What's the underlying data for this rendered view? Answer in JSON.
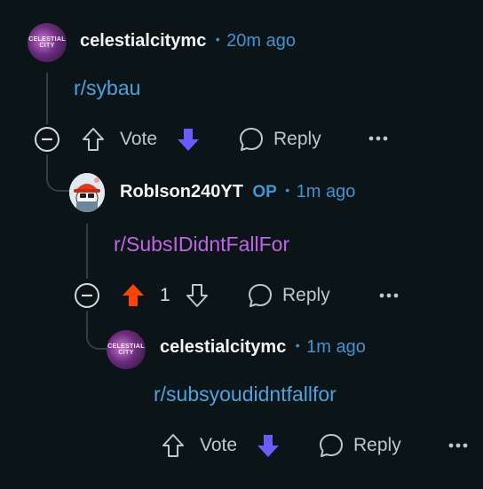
{
  "comments": [
    {
      "username": "celestialcitymc",
      "time": "20m ago",
      "body": "r/sybau",
      "vote_label": "Vote",
      "reply_label": "Reply",
      "avatar_text": "CELESTIAL CITY"
    },
    {
      "username": "RobIson240YT",
      "op_badge": "OP",
      "time": "1m ago",
      "body": "r/SubsIDidntFallFor",
      "vote_count": "1",
      "reply_label": "Reply"
    },
    {
      "username": "celestialcitymc",
      "time": "1m ago",
      "body": "r/subsyoudidntfallfor",
      "vote_label": "Vote",
      "reply_label": "Reply",
      "avatar_text": "CELESTIAL CITY"
    }
  ],
  "separator": "•",
  "icons": {
    "collapse": "minus-circle-icon",
    "upvote": "arrow-up-icon",
    "downvote": "arrow-down-icon",
    "reply": "speech-bubble-icon",
    "more": "ellipsis-icon"
  },
  "colors": {
    "background": "#0b1416",
    "link_blue": "#4aa3e0",
    "link_purple": "#c264e8",
    "meta_blue": "#3d94d6",
    "downvote": "#6a5cff",
    "upvote": "#ff4500"
  }
}
